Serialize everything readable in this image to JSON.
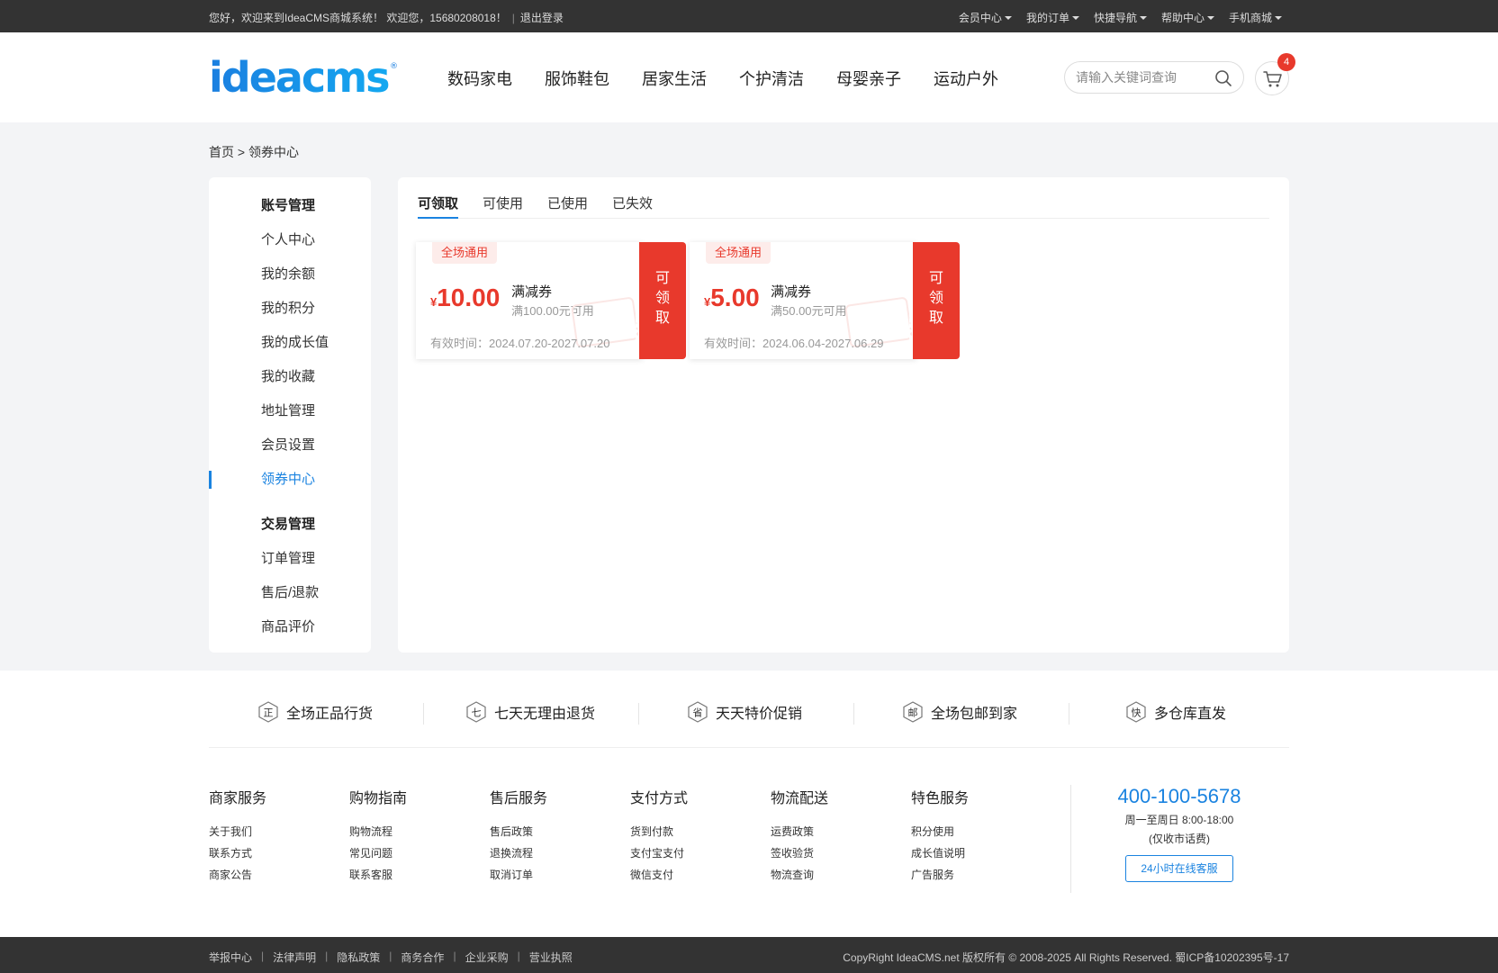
{
  "topbar": {
    "greeting": "您好，欢迎来到IdeaCMS商城系统！ 欢迎您，15680208018！",
    "logout": "退出登录",
    "menus": [
      {
        "label": "会员中心"
      },
      {
        "label": "我的订单"
      },
      {
        "label": "快捷导航"
      },
      {
        "label": "帮助中心"
      },
      {
        "label": "手机商城"
      }
    ]
  },
  "header": {
    "logo_text": "ideacms",
    "nav": [
      "数码家电",
      "服饰鞋包",
      "居家生活",
      "个护清洁",
      "母婴亲子",
      "运动户外"
    ],
    "search_placeholder": "请输入关键词查询",
    "cart_count": "4"
  },
  "breadcrumb": "首页 > 领券中心",
  "sidebar": {
    "group1": "账号管理",
    "group1_items": [
      "个人中心",
      "我的余额",
      "我的积分",
      "我的成长值",
      "我的收藏",
      "地址管理",
      "会员设置",
      "领券中心"
    ],
    "group2": "交易管理",
    "group2_items": [
      "订单管理",
      "售后/退款",
      "商品评价"
    ],
    "active": "领券中心"
  },
  "tabs": [
    "可领取",
    "可使用",
    "已使用",
    "已失效"
  ],
  "active_tab": "可领取",
  "coupons": [
    {
      "tag": "全场通用",
      "currency": "¥",
      "amount": "10.00",
      "type": "满减券",
      "condition": "满100.00元可用",
      "validity": "有效时间：2024.07.20-2027.07.20",
      "action": "可领取"
    },
    {
      "tag": "全场通用",
      "currency": "¥",
      "amount": "5.00",
      "type": "满减券",
      "condition": "满50.00元可用",
      "validity": "有效时间：2024.06.04-2027.06.29",
      "action": "可领取"
    }
  ],
  "features": [
    {
      "icon_char": "正",
      "label": "全场正品行货"
    },
    {
      "icon_char": "七",
      "label": "七天无理由退货"
    },
    {
      "icon_char": "省",
      "label": "天天特价促销"
    },
    {
      "icon_char": "邮",
      "label": "全场包邮到家"
    },
    {
      "icon_char": "快",
      "label": "多仓库直发"
    }
  ],
  "footer_cols": [
    {
      "title": "商家服务",
      "links": [
        "关于我们",
        "联系方式",
        "商家公告"
      ]
    },
    {
      "title": "购物指南",
      "links": [
        "购物流程",
        "常见问题",
        "联系客服"
      ]
    },
    {
      "title": "售后服务",
      "links": [
        "售后政策",
        "退换流程",
        "取消订单"
      ]
    },
    {
      "title": "支付方式",
      "links": [
        "货到付款",
        "支付宝支付",
        "微信支付"
      ]
    },
    {
      "title": "物流配送",
      "links": [
        "运费政策",
        "签收验货",
        "物流查询"
      ]
    },
    {
      "title": "特色服务",
      "links": [
        "积分使用",
        "成长值说明",
        "广告服务"
      ]
    }
  ],
  "contact": {
    "phone": "400-100-5678",
    "hours": "周一至周日 8:00-18:00",
    "note": "(仅收市话费)",
    "service_button": "24小时在线客服"
  },
  "bottom": {
    "links": [
      "举报中心",
      "法律声明",
      "隐私政策",
      "商务合作",
      "企业采购",
      "营业执照"
    ],
    "copyright": "CopyRight IdeaCMS.net 版权所有 © 2008-2025 All Rights Reserved. 蜀ICP备10202395号-17"
  },
  "colors": {
    "accent": "#1a83e0",
    "coupon_red": "#e8392c",
    "topbar_bg": "#333333"
  }
}
